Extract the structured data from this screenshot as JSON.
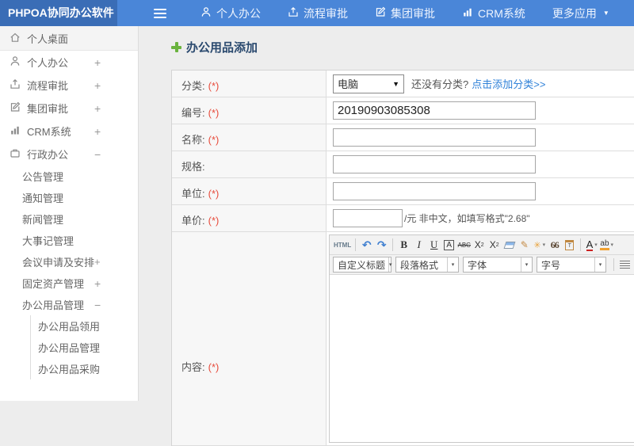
{
  "colors": {
    "header_logo_bg": "#3a6db6",
    "header_nav_bg": "#4a86d8",
    "link_blue": "#2f81d8",
    "title_navy": "#2b4a6f",
    "plus_green": "#6ab33e",
    "required_red": "#e74c3c"
  },
  "icons": {
    "caret_down": "▼",
    "dd_caret": "▾",
    "undo": "↶",
    "redo": "↷",
    "brush": "✎",
    "wand": "✳",
    "paste_t": "T",
    "link_glyph": "∞"
  },
  "header": {
    "logo": "PHPOA协同办公软件",
    "nav": [
      {
        "label": "个人办公"
      },
      {
        "label": "流程审批"
      },
      {
        "label": "集团审批"
      },
      {
        "label": "CRM系统"
      },
      {
        "label": "更多应用"
      }
    ]
  },
  "sidebar": {
    "items": [
      {
        "label": "个人桌面",
        "toggle": ""
      },
      {
        "label": "个人办公",
        "toggle": "+"
      },
      {
        "label": "流程审批",
        "toggle": "+"
      },
      {
        "label": "集团审批",
        "toggle": "+"
      },
      {
        "label": "CRM系统",
        "toggle": "+"
      },
      {
        "label": "行政办公",
        "toggle": "−"
      }
    ],
    "sub_items": [
      {
        "label": "公告管理",
        "toggle": ""
      },
      {
        "label": "通知管理",
        "toggle": ""
      },
      {
        "label": "新闻管理",
        "toggle": ""
      },
      {
        "label": "大事记管理",
        "toggle": ""
      },
      {
        "label": "会议申请及安排",
        "toggle": "+"
      },
      {
        "label": "固定资产管理",
        "toggle": "+"
      },
      {
        "label": "办公用品管理",
        "toggle": "−"
      }
    ],
    "leaf_items": [
      {
        "label": "办公用品领用"
      },
      {
        "label": "办公用品管理"
      },
      {
        "label": "办公用品采购"
      }
    ]
  },
  "main": {
    "title": "办公用品添加",
    "form": {
      "category": {
        "label": "分类:",
        "required": "(*)",
        "selected": "电脑",
        "hint": "还没有分类?",
        "link": "点击添加分类>>"
      },
      "code": {
        "label": "编号:",
        "required": "(*)",
        "value": "20190903085308"
      },
      "name": {
        "label": "名称:",
        "required": "(*)",
        "value": ""
      },
      "spec": {
        "label": "规格:",
        "required": "",
        "value": ""
      },
      "unit": {
        "label": "单位:",
        "required": "(*)",
        "value": ""
      },
      "price": {
        "label": "单价:",
        "required": "(*)",
        "value": "",
        "suffix": "/元 非中文，如填写格式\"2.68\""
      },
      "content": {
        "label": "内容:",
        "required": "(*)"
      }
    }
  },
  "editor": {
    "html_button": "HTML",
    "bold": "B",
    "italic": "I",
    "underline": "U",
    "boxed_a": "A",
    "strike": "ABC",
    "sup_base": "X",
    "sup_exp": "2",
    "sub_base": "X",
    "sub_idx": "2",
    "quote": "66",
    "font_color": "A",
    "highlight": "ab",
    "dropdowns": [
      {
        "label": "自定义标题"
      },
      {
        "label": "段落格式"
      },
      {
        "label": "字体"
      },
      {
        "label": "字号"
      }
    ]
  }
}
